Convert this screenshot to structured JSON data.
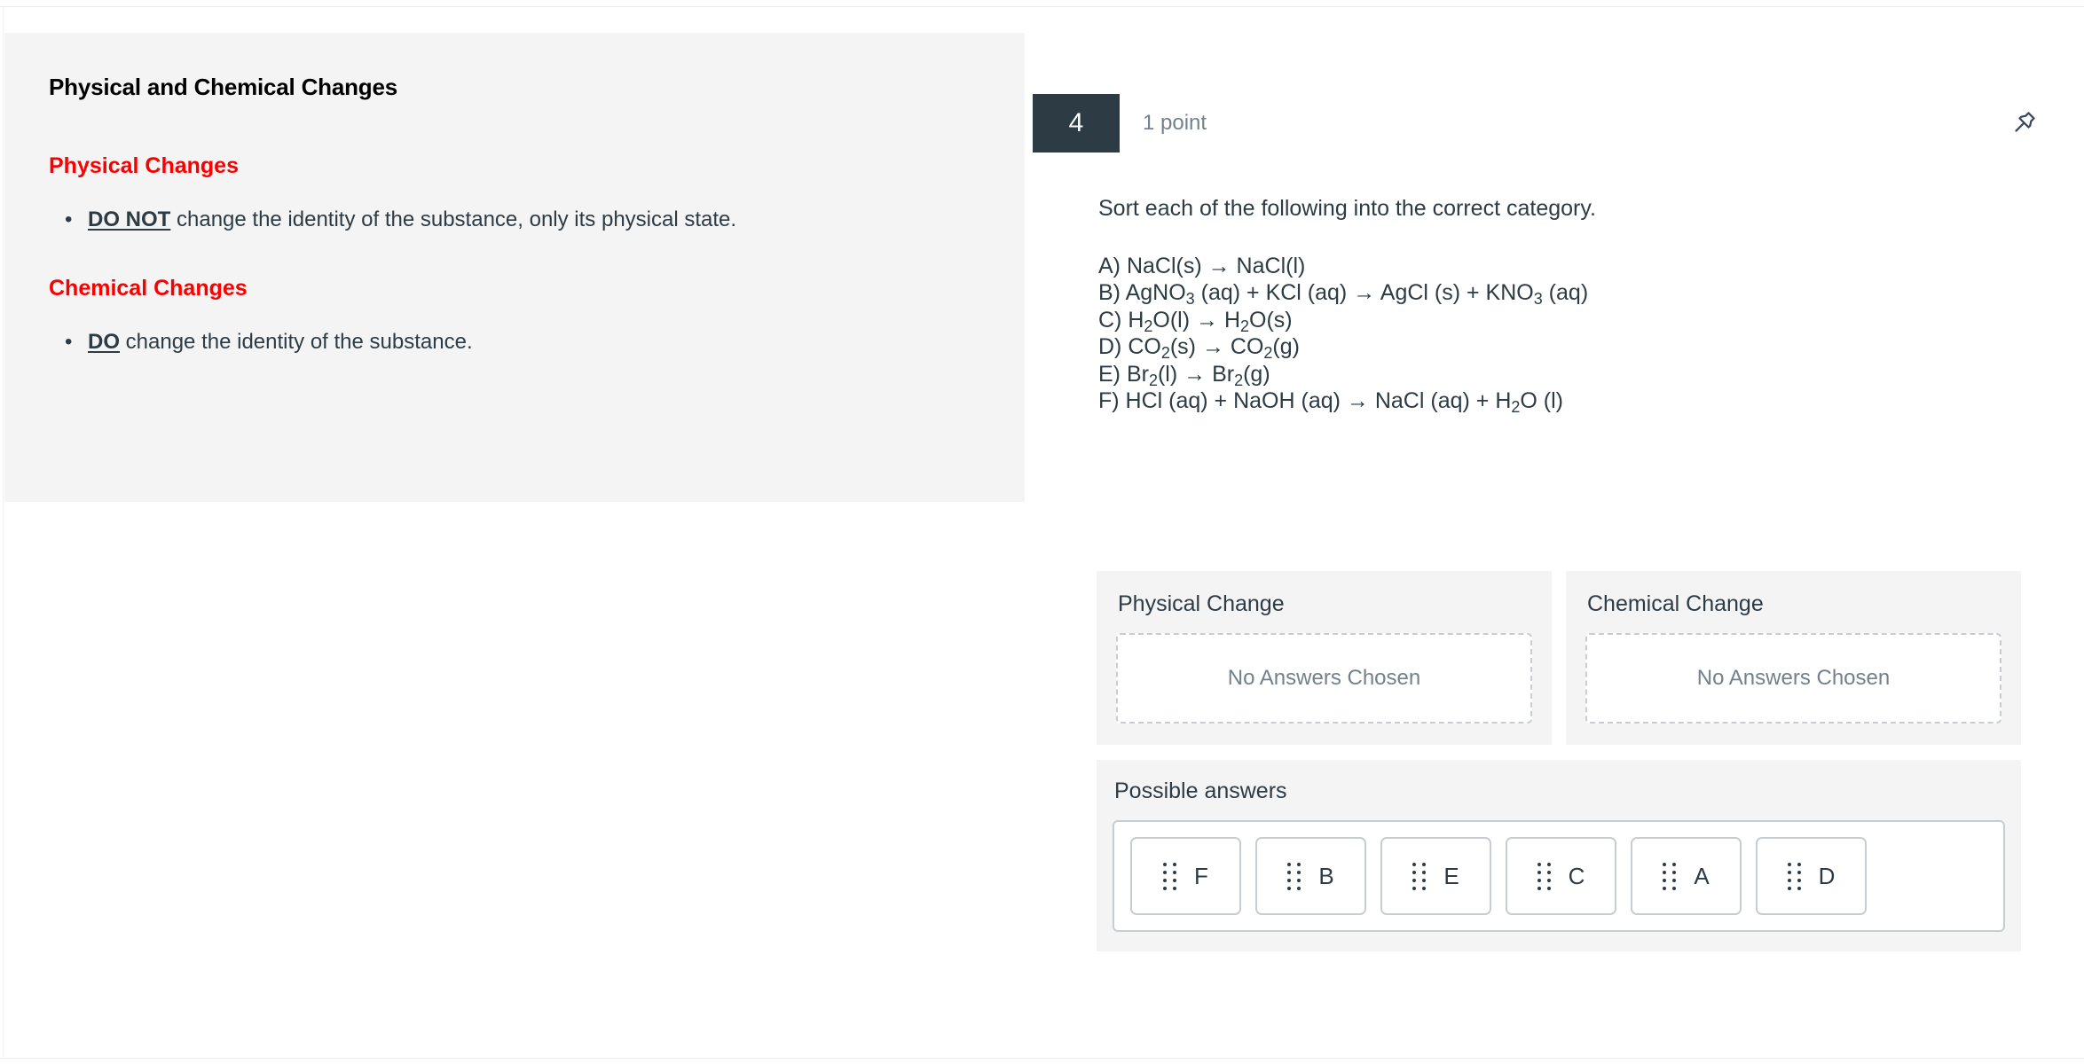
{
  "stimulus": {
    "title": "Physical and Chemical Changes",
    "sections": [
      {
        "heading": "Physical Changes",
        "bullet_emph": "DO NOT",
        "bullet_rest": " change the identity of the substance, only its physical state."
      },
      {
        "heading": "Chemical Changes",
        "bullet_emph": "DO",
        "bullet_rest": " change the identity of the substance."
      }
    ],
    "heading_color": "#fa0000"
  },
  "question": {
    "number": "4",
    "points_label": "1 point",
    "pin_icon": "pushpin-icon",
    "prompt": "Sort each of the following into the correct category.",
    "equations": [
      "A) NaCl(s) → NaCl(l)",
      "B) AgNO3 (aq) + KCl (aq) → AgCl (s) + KNO3 (aq)",
      "C) H2O(l) → H2O(s)",
      "D) CO2(s) → CO2(g)",
      "E) Br2(l) → Br2(g)",
      "F) HCl (aq) + NaOH (aq) → NaCl (aq) + H2O (l)"
    ],
    "badge_color": "#2d3b45"
  },
  "answer_area": {
    "buckets": [
      {
        "title": "Physical Change",
        "empty_text": "No Answers Chosen"
      },
      {
        "title": "Chemical Change",
        "empty_text": "No Answers Chosen"
      }
    ],
    "pool": {
      "title": "Possible answers",
      "tiles": [
        {
          "label": "F"
        },
        {
          "label": "B"
        },
        {
          "label": "E"
        },
        {
          "label": "C"
        },
        {
          "label": "A"
        },
        {
          "label": "D"
        }
      ]
    }
  }
}
